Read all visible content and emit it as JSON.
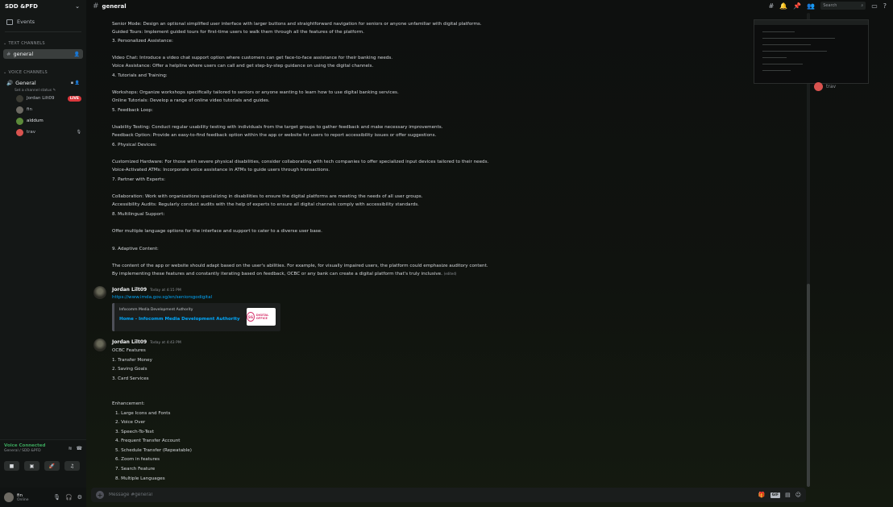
{
  "server": {
    "name": "SDD &PFD"
  },
  "sidebar": {
    "events_label": "Events",
    "text_category": "TEXT CHANNELS",
    "text_channels": [
      {
        "name": "general"
      }
    ],
    "voice_category": "VOICE CHANNELS",
    "voice_channel": {
      "name": "General",
      "status": "Set a channel status"
    },
    "voice_users": [
      {
        "name": "Jordan Lilt09",
        "live": "LIVE"
      },
      {
        "name": "fin"
      },
      {
        "name": "alddum"
      },
      {
        "name": "trav"
      }
    ]
  },
  "voice_panel": {
    "title": "Voice Connected",
    "subtitle": "General / SDD &PFD"
  },
  "user_panel": {
    "name": "fin",
    "status": "Online"
  },
  "channel": {
    "name": "general"
  },
  "search": {
    "placeholder": "Search"
  },
  "messages": {
    "lines": [
      "Senior Mode: Design an optional simplified user interface with larger buttons and straightforward navigation for seniors or anyone unfamiliar with digital platforms.",
      "Guided Tours: Implement guided tours for first-time users to walk them through all the features of the platform.",
      "3. Personalized Assistance:",
      "Video Chat: Introduce a video chat support option where customers can get face-to-face assistance for their banking needs.",
      "Voice Assistance: Offer a helpline where users can call and get step-by-step guidance on using the digital channels.",
      "4. Tutorials and Training:",
      "Workshops: Organize workshops specifically tailored to seniors or anyone wanting to learn how to use digital banking services.",
      "Online Tutorials: Develop a range of online video tutorials and guides.",
      "5. Feedback Loop:",
      "Usability Testing: Conduct regular usability testing with individuals from the target groups to gather feedback and make necessary improvements.",
      "Feedback Option: Provide an easy-to-find feedback option within the app or website for users to report accessibility issues or offer suggestions.",
      "6. Physical Devices:",
      "Customized Hardware: For those with severe physical disabilities, consider collaborating with tech companies to offer specialized input devices tailored to their needs.",
      "Voice-Activated ATMs: Incorporate voice assistance in ATMs to guide users through transactions.",
      "7. Partner with Experts:",
      "Collaboration: Work with organizations specializing in disabilities to ensure the digital platforms are meeting the needs of all user groups.",
      "Accessibility Audits: Regularly conduct audits with the help of experts to ensure all digital channels comply with accessibility standards.",
      "8. Multilingual Support:",
      "Offer multiple language options for the interface and support to cater to a diverse user base.",
      "9. Adaptive Content:",
      "The content of the app or website should adapt based on the user's abilities. For example, for visually impaired users, the platform could emphasize auditory content.",
      "By implementing these features and constantly iterating based on feedback, OCBC or any bank can create a digital platform that's truly inclusive."
    ],
    "edited": "(edited)",
    "msg2": {
      "author": "Jordan Lilt09",
      "time": "Today at 4:15 PM",
      "link": "https://www.imda.gov.sg/en/seniorsgodigital",
      "embed_provider": "Infocomm Media Development Authority",
      "embed_title": "Home - Infocomm Media Development Authority",
      "thumb_badge": "SG",
      "thumb_text": "DIGITAL OFFICE"
    },
    "msg3": {
      "author": "Jordan Lilt09",
      "time": "Today at 4:43 PM",
      "lines": [
        "OCBC Features",
        "1. Transfer Money",
        "2. Saving Goals",
        "3. Card Services",
        "Enhancement:",
        "1. Large Icons and Fonts",
        "2. Voice Over",
        "3. Speech-To-Text",
        "4. Frequent Transfer Account",
        "5. Schedule Transfer (Repeatable)",
        "6. Zoom in features",
        "7. Search Feature",
        "8. Multiple Languages"
      ]
    }
  },
  "composer": {
    "placeholder": "Message #general",
    "gif": "GIF"
  },
  "members": [
    {
      "name": "trav"
    }
  ],
  "colors": {
    "accent": "#00a8fc",
    "online": "#3ba55c",
    "live": "#da373c"
  }
}
